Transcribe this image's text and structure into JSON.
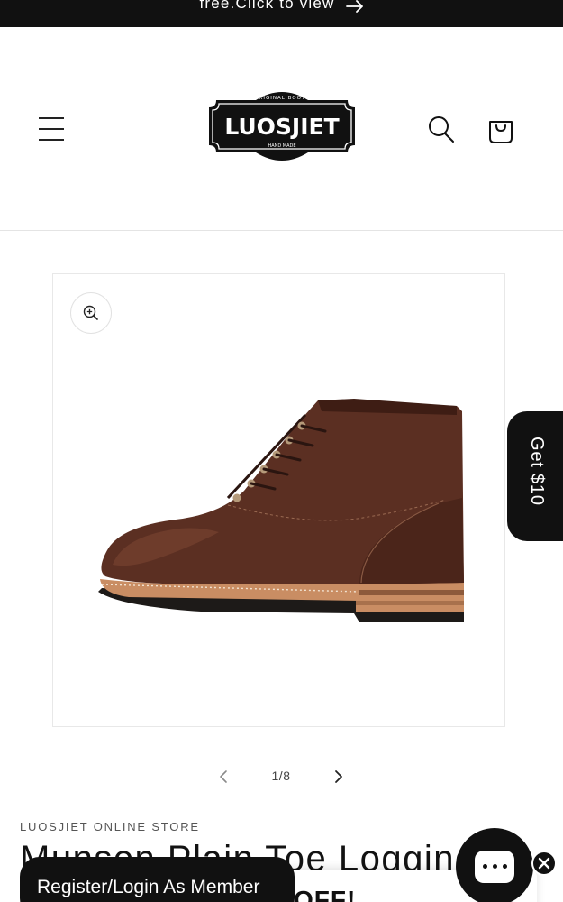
{
  "announcement": {
    "text": "free.Click to view"
  },
  "header": {
    "logo": {
      "brand": "LUOSJIET",
      "arc_text": "ORIGINAL BOOTS",
      "sub_text": "HAND MADE"
    }
  },
  "gallery": {
    "counter": "1/8",
    "image_alt": "Brown leather lace-up logging boot, side view"
  },
  "side_tab": {
    "label": "Get $10"
  },
  "product": {
    "vendor": "LUOSJIET ONLINE STORE",
    "title": "Munson Plain Toe Logging"
  },
  "promo": {
    "register_label": "Register/Login As Member",
    "off_label": "OFF!"
  },
  "colors": {
    "dark": "#111111",
    "leather": "#5b2f22",
    "accent_sole": "#c98d63"
  }
}
